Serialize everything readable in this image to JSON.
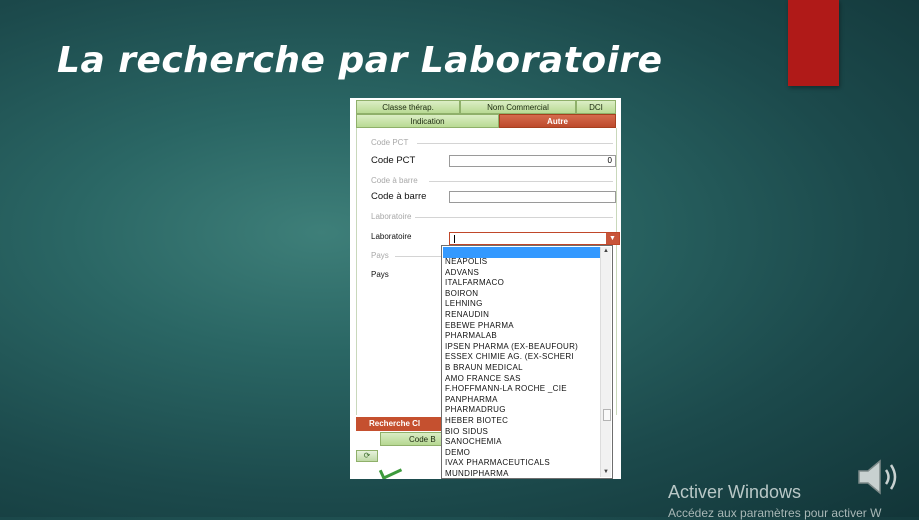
{
  "slide": {
    "title": "La recherche par Laboratoire"
  },
  "tabs": {
    "row1": [
      "Classe thérap.",
      "Nom Commercial",
      "DCI"
    ],
    "row2": [
      "Indication",
      "Autre"
    ],
    "active": "Autre"
  },
  "form": {
    "groups": {
      "code_pct": "Code PCT",
      "code_barre": "Code à barre",
      "laboratoire": "Laboratoire",
      "pays": "Pays"
    },
    "fields": {
      "code_pct_label": "Code PCT",
      "code_pct_value": "0",
      "code_barre_label": "Code à barre",
      "code_barre_value": "",
      "laboratoire_label": "Laboratoire",
      "laboratoire_value": "",
      "pays_label": "Pays"
    }
  },
  "dropdown": {
    "items": [
      "NEAPOLIS",
      "ADVANS",
      "ITALFARMACO",
      "BOIRON",
      "LEHNING",
      "RENAUDIN",
      "EBEWE PHARMA",
      "PHARMALAB",
      "IPSEN PHARMA (EX-BEAUFOUR)",
      "ESSEX CHIMIE AG. (EX-SCHERI",
      "B BRAUN MEDICAL",
      "AMO FRANCE SAS",
      "F.HOFFMANN-LA ROCHE _CIE",
      "PANPHARMA",
      "PHARMADRUG",
      "HEBER BIOTEC",
      "BIO SIDUS",
      "SANOCHEMIA",
      "DEMO",
      "IVAX PHARMACEUTICALS",
      "MUNDIPHARMA"
    ]
  },
  "buttons": {
    "recherche": "Recherche Cl",
    "code": "Code B"
  },
  "windows_watermark": {
    "line1": "Activer Windows",
    "line2": "Accédez aux paramètres pour activer W"
  },
  "icons": {
    "speaker": "speaker-icon",
    "dropdown_arrow": "chevron-down-icon",
    "refresh": "refresh-icon",
    "checkmark": "checkmark-icon"
  },
  "colors": {
    "accent_red": "#b01a18",
    "tab_active": "#c5502f",
    "tab_green": "#c6e3a8",
    "selection_blue": "#3399ff"
  }
}
